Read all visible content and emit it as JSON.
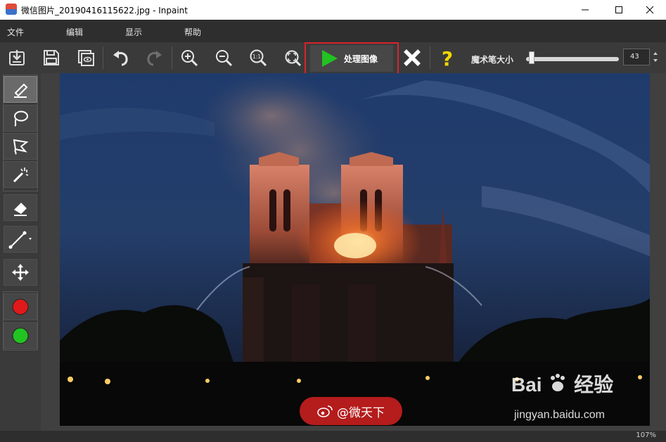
{
  "window": {
    "title": "微信图片_20190416115622.jpg - Inpaint"
  },
  "menu": {
    "items": [
      "文件",
      "编辑",
      "显示",
      "帮助"
    ]
  },
  "toolbar": {
    "buttons": [
      "open-icon",
      "save-icon",
      "preview-icon",
      "undo-icon",
      "redo-icon",
      "zoom-in-icon",
      "zoom-out-icon",
      "actual-size-icon",
      "fit-window-icon"
    ],
    "process_label": "处理图像",
    "magic_wand_label": "魔术笔大小",
    "magic_wand_size": "43",
    "magic_wand_level": 0.06
  },
  "tools": {
    "items": [
      "marker-icon",
      "lasso-icon",
      "polygon-lasso-icon",
      "magic-wand-icon",
      "eraser-icon",
      "line-icon",
      "move-icon",
      "red-color-icon",
      "green-color-icon"
    ]
  },
  "status": {
    "zoom": "107%"
  },
  "watermarks": {
    "weibo": "@微天下",
    "baidu_brand": "Bai",
    "baidu_brand_cn": "经验",
    "baidu_url": "jingyan.baidu.com"
  },
  "colors": {
    "accent_red": "#d9232e",
    "process_green": "#22c222",
    "help_yellow": "#f2d600",
    "tool_red": "#e01a1a",
    "tool_green": "#22c422"
  }
}
